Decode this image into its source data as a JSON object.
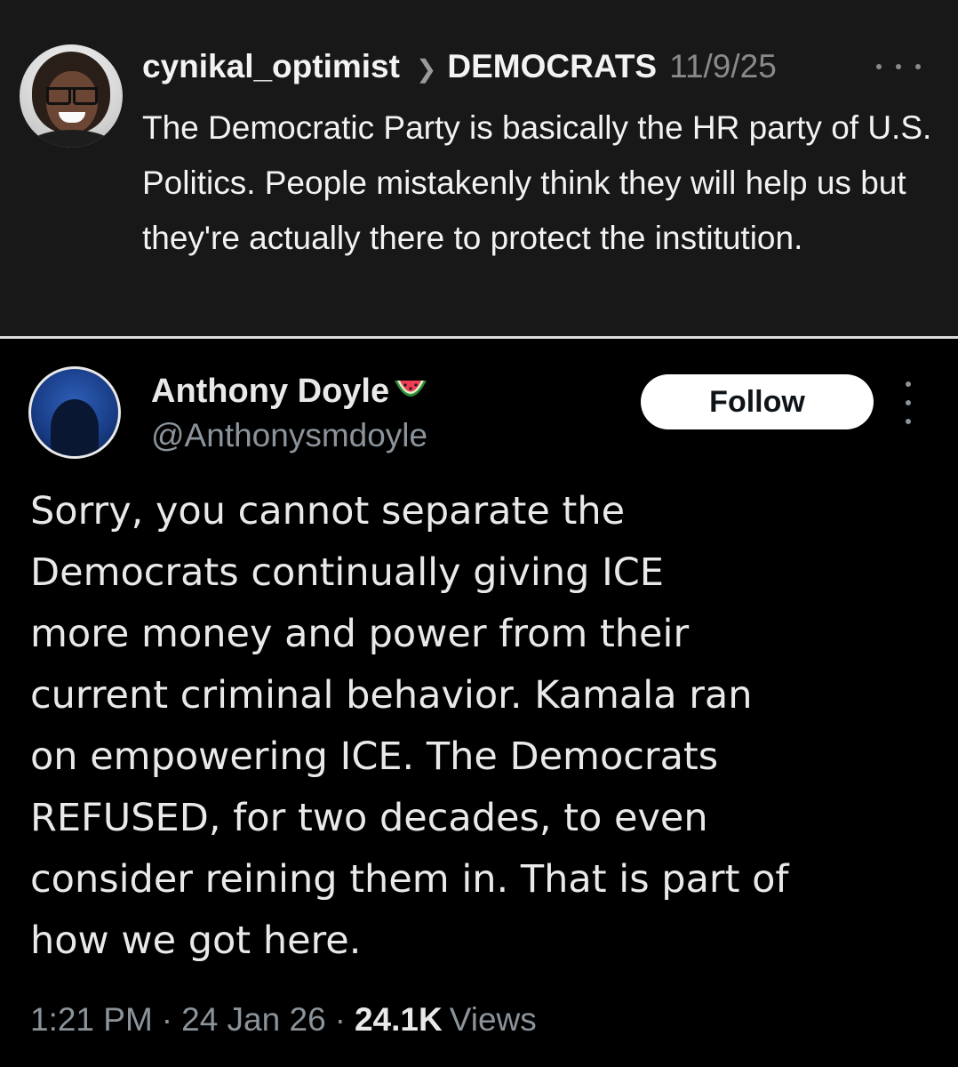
{
  "top_post": {
    "username": "cynikal_optimist",
    "community": "DEMOCRATS",
    "date": "11/9/25",
    "body": "The Democratic Party is basically the HR party of U.S. Politics. People mistakenly think they will help us but they're actually there to protect the institution.",
    "more_icon": "ellipsis-horizontal-icon"
  },
  "x_post": {
    "display_name": "Anthony Doyle",
    "name_emoji": "watermelon-icon",
    "handle": "@Anthonysmdoyle",
    "follow_label": "Follow",
    "more_icon": "ellipsis-vertical-icon",
    "body": "Sorry, you cannot separate the\nDemocrats continually giving ICE\nmore money and power from their\ncurrent criminal behavior. Kamala ran\non empowering ICE. The Democrats\nREFUSED, for two decades, to even\nconsider reining them in. That is part of\nhow we got here.",
    "time": "1:21 PM",
    "date": "24 Jan 26",
    "views_count": "24.1K",
    "views_label": "Views"
  },
  "colors": {
    "top_background": "#181818",
    "bottom_background": "#000000",
    "muted_text": "#8b949b",
    "divider": "#dcdcdc"
  }
}
